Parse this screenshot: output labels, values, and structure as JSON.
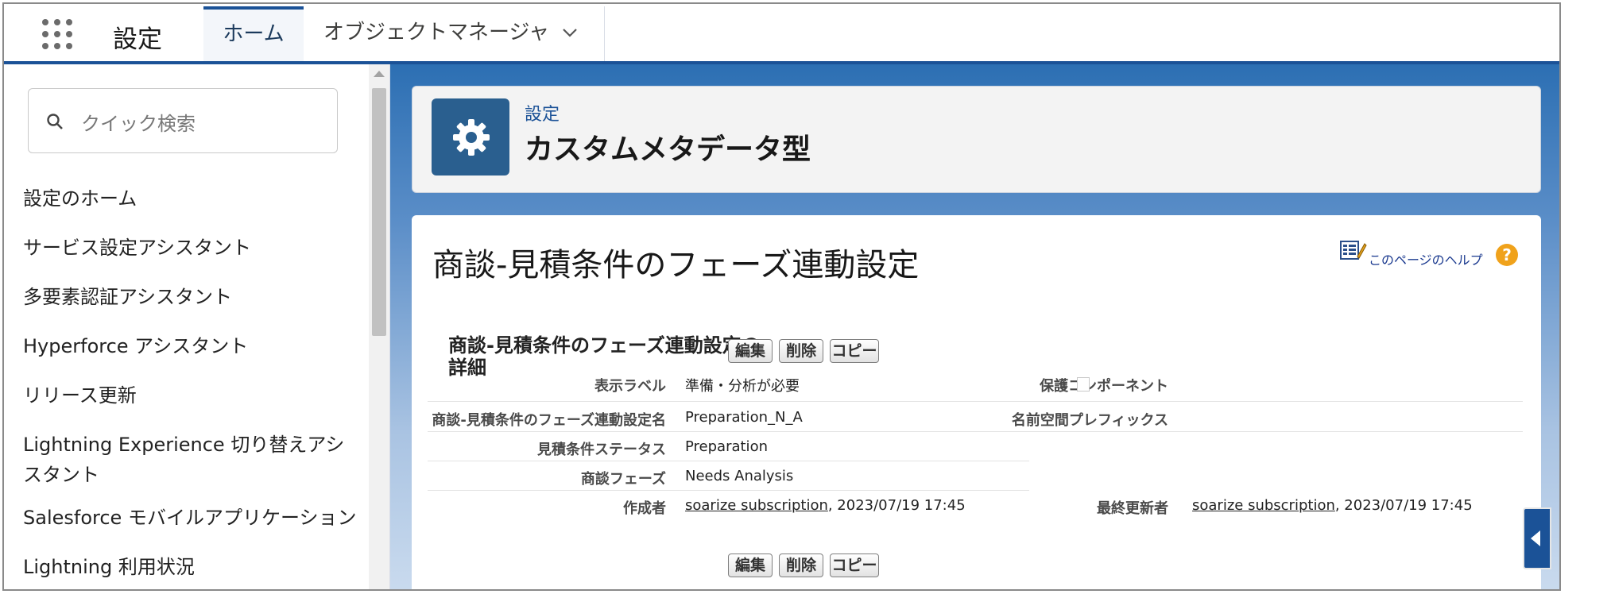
{
  "header": {
    "app_title": "設定",
    "tabs": [
      {
        "label": "ホーム",
        "active": true
      },
      {
        "label": "オブジェクトマネージャ",
        "active": false
      }
    ]
  },
  "sidebar": {
    "search_placeholder": "クイック検索",
    "items": [
      {
        "label": "設定のホーム"
      },
      {
        "label": "サービス設定アシスタント"
      },
      {
        "label": "多要素認証アシスタント"
      },
      {
        "label": "Hyperforce アシスタント"
      },
      {
        "label": "リリース更新"
      },
      {
        "label": "Lightning Experience 切り替えアシスタント"
      },
      {
        "label": "Salesforce モバイルアプリケーション"
      },
      {
        "label": "Lightning 利用状況"
      }
    ]
  },
  "page_header": {
    "breadcrumb": "設定",
    "title": "カスタムメタデータ型"
  },
  "detail": {
    "page_title": "商談-見積条件のフェーズ連動設定",
    "help_link": "このページのヘルプ",
    "help_icon": "?",
    "section_title": "商談-見積条件のフェーズ連動設定の詳細",
    "buttons": {
      "edit": "編集",
      "delete": "削除",
      "copy": "コピー"
    },
    "fields": {
      "display_label": {
        "label": "表示ラベル",
        "value": "準備・分析が必要"
      },
      "api_name": {
        "label": "商談-見積条件のフェーズ連動設定名",
        "value": "Preparation_N_A"
      },
      "quote_status": {
        "label": "見積条件ステータス",
        "value": "Preparation"
      },
      "opp_phase": {
        "label": "商談フェーズ",
        "value": "Needs Analysis"
      },
      "created_by": {
        "label": "作成者",
        "user": "soarize subscription",
        "date": ", 2023/07/19 17:45"
      },
      "protected": {
        "label": "保護コンポーネント",
        "checked": false
      },
      "namespace": {
        "label": "名前空間プレフィックス",
        "value": ""
      },
      "modified_by": {
        "label": "最終更新者",
        "user": "soarize subscription",
        "date": ", 2023/07/19 17:45"
      }
    }
  },
  "colors": {
    "brand": "#1b5297",
    "gear_tile": "#2a5f8f",
    "help_icon": "#f0a21b"
  },
  "icons": [
    "app-launcher-icon",
    "chevron-down-icon",
    "search-icon",
    "gear-icon",
    "help-page-icon",
    "question-icon",
    "collapse-left-icon"
  ]
}
